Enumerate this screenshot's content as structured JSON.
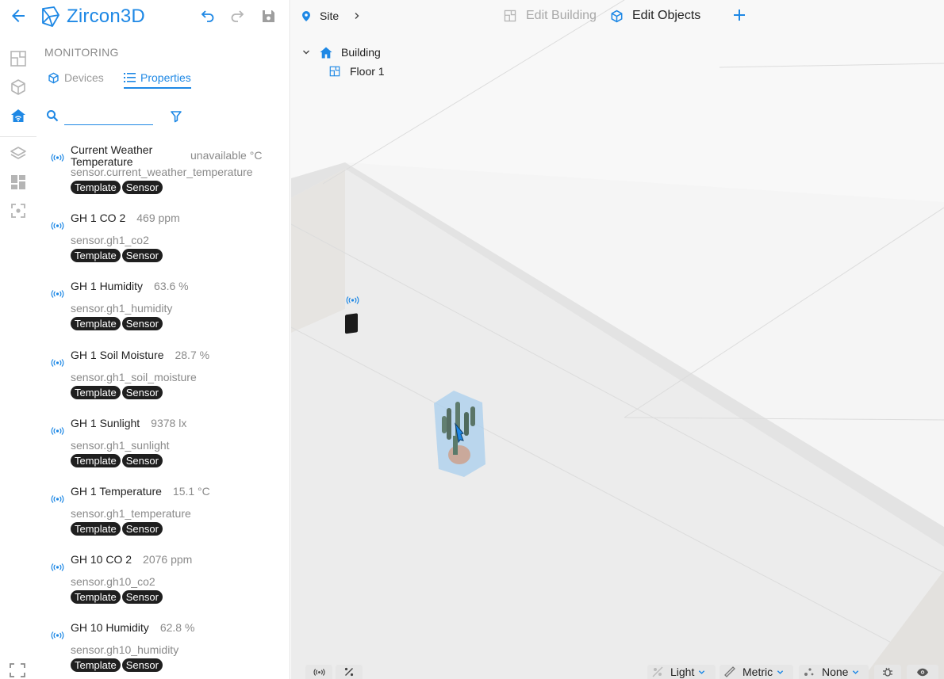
{
  "app": {
    "title": "Zircon3D"
  },
  "panel": {
    "section": "MONITORING",
    "tabs": [
      {
        "label": "Devices",
        "active": false
      },
      {
        "label": "Properties",
        "active": true
      }
    ],
    "search": {
      "value": "",
      "placeholder": ""
    }
  },
  "entities": [
    {
      "name": "Current Weather Temperature",
      "value": "unavailable °C",
      "id": "sensor.current_weather_temperature",
      "tags": [
        "Template",
        "Sensor"
      ]
    },
    {
      "name": "GH 1 CO 2",
      "value": "469 ppm",
      "id": "sensor.gh1_co2",
      "tags": [
        "Template",
        "Sensor"
      ]
    },
    {
      "name": "GH 1 Humidity",
      "value": "63.6 %",
      "id": "sensor.gh1_humidity",
      "tags": [
        "Template",
        "Sensor"
      ]
    },
    {
      "name": "GH 1 Soil Moisture",
      "value": "28.7 %",
      "id": "sensor.gh1_soil_moisture",
      "tags": [
        "Template",
        "Sensor"
      ]
    },
    {
      "name": "GH 1 Sunlight",
      "value": "9378 lx",
      "id": "sensor.gh1_sunlight",
      "tags": [
        "Template",
        "Sensor"
      ]
    },
    {
      "name": "GH 1 Temperature",
      "value": "15.1 °C",
      "id": "sensor.gh1_temperature",
      "tags": [
        "Template",
        "Sensor"
      ]
    },
    {
      "name": "GH 10 CO 2",
      "value": "2076 ppm",
      "id": "sensor.gh10_co2",
      "tags": [
        "Template",
        "Sensor"
      ]
    },
    {
      "name": "GH 10 Humidity",
      "value": "62.8 %",
      "id": "sensor.gh10_humidity",
      "tags": [
        "Template",
        "Sensor"
      ]
    }
  ],
  "viewport": {
    "breadcrumb": "Site",
    "modes": [
      {
        "label": "Edit Building",
        "active": false
      },
      {
        "label": "Edit Objects",
        "active": true
      }
    ],
    "tree": [
      {
        "label": "Building",
        "icon": "home-icon"
      },
      {
        "label": "Floor 1",
        "icon": "floorplan-icon"
      }
    ],
    "bottom": {
      "lighting": "Light",
      "units": "Metric",
      "overlay": "None"
    }
  },
  "colors": {
    "accent": "#1e88e5",
    "chip": "#1f1f1f",
    "muted": "#8a8a8a"
  }
}
